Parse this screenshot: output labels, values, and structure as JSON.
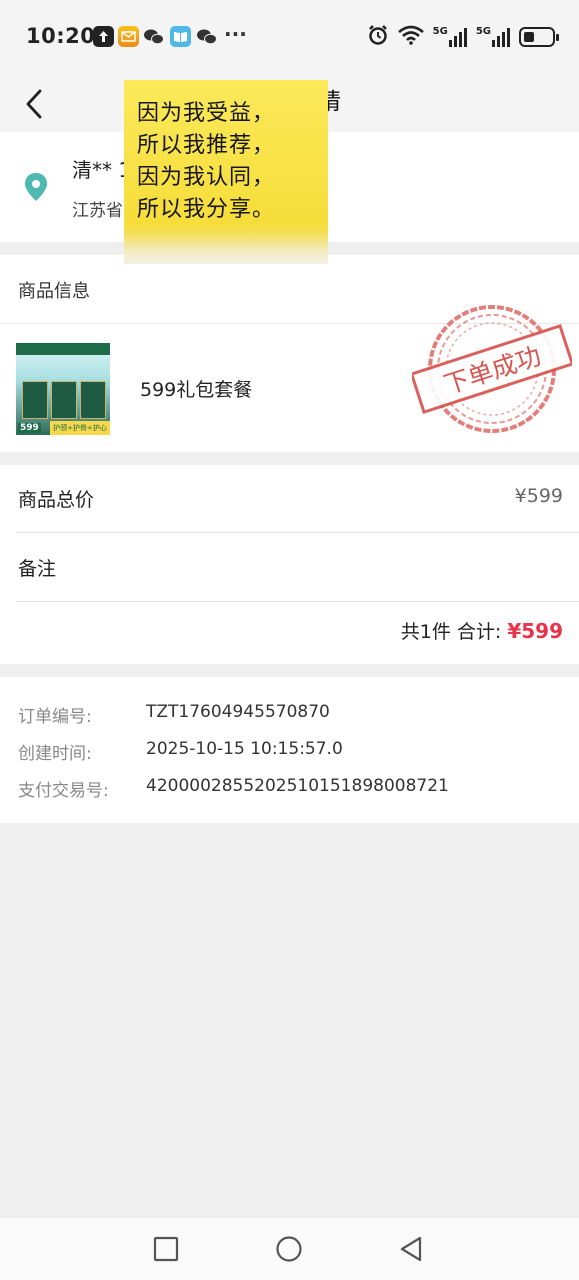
{
  "status_bar": {
    "time": "10:20",
    "icons": [
      "upload-icon",
      "mail-icon",
      "wechat-icon",
      "book-icon",
      "wechat-icon",
      "more-dots-icon"
    ],
    "dots": "···",
    "right_icons": [
      "alarm-icon",
      "wifi-icon",
      "signal-5g-icon",
      "signal-5g-icon",
      "battery-icon"
    ],
    "network_1": "5G",
    "network_2": "5G",
    "battery_level": 0.4
  },
  "nav": {
    "title": "请"
  },
  "overlay_note": {
    "lines": [
      "因为我受益，",
      "所以我推荐，",
      "因为我认同，",
      "所以我分享。"
    ]
  },
  "address": {
    "name": "清** 1",
    "detail": "江苏省"
  },
  "products": {
    "section_title": "商品信息",
    "item": {
      "name": "599礼包套餐",
      "thumb_price": "599",
      "thumb_tag": "护颈+护骨+护心"
    },
    "stamp_text": "下单成功"
  },
  "price": {
    "total_label": "商品总价",
    "total_value": "¥599",
    "remark_label": "备注",
    "summary_prefix": "共1件 合计:",
    "summary_amount": "¥599"
  },
  "order_info": {
    "order_no_label": "订单编号:",
    "order_no_value": "TZT17604945570870",
    "created_label": "创建时间:",
    "created_value": "2025-10-15 10:15:57.0",
    "payment_label": "支付交易号:",
    "payment_value": "4200002855202510151898008721"
  },
  "colors": {
    "accent_red": "#e8334a",
    "pin_teal": "#4fb8b0",
    "stamp_red": "#d9534f"
  }
}
